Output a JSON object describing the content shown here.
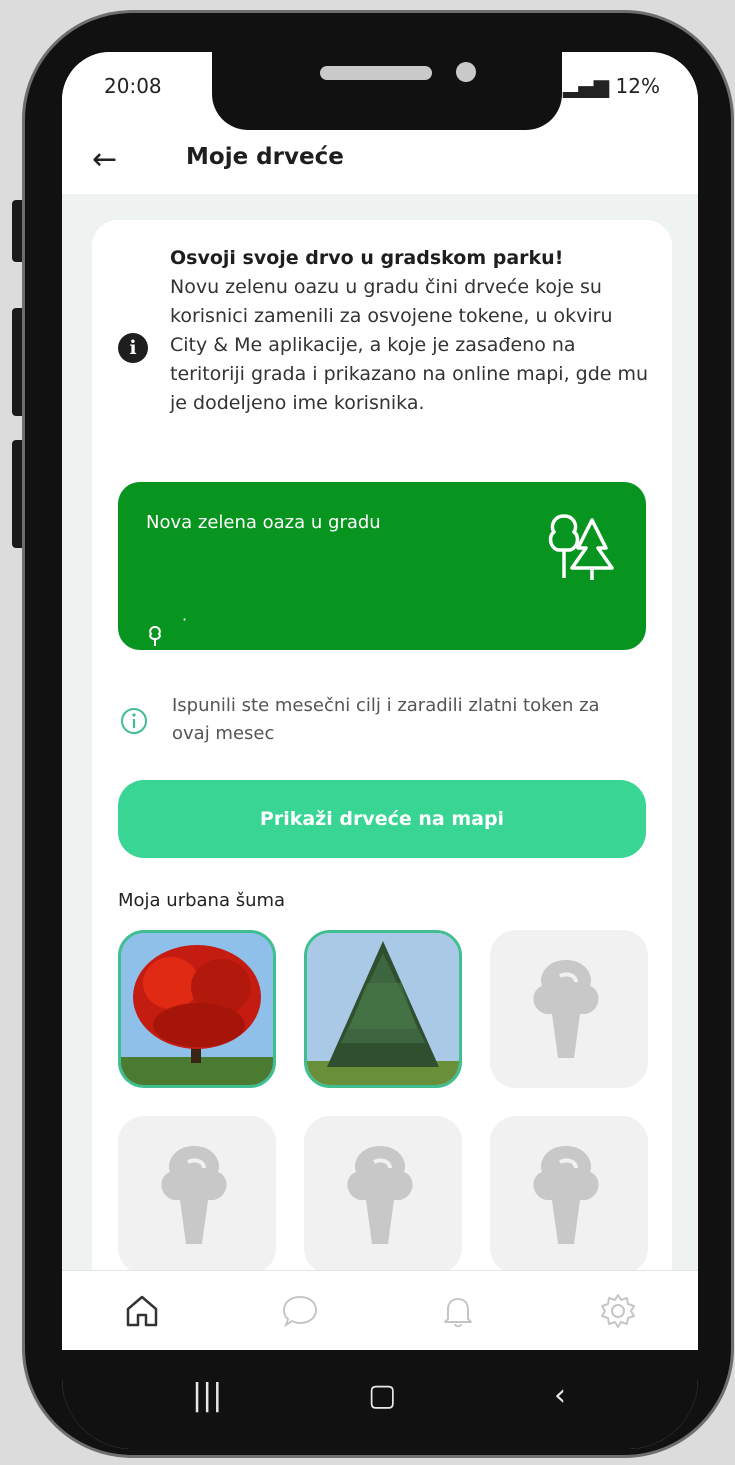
{
  "status_bar": {
    "time": "20:08",
    "battery": "12%"
  },
  "header": {
    "title": "Moje drveće"
  },
  "intro": {
    "title": "Osvoji svoje drvo u gradskom parku!",
    "text": "Novu zelenu oazu u gradu čini drveće koje su korisnici zamenili za osvojene tokene, u okviru City & Me aplikacije, a koje je zasađeno na teritoriji grada i prikazano na online mapi, gde mu je dodeljeno ime korisnika."
  },
  "banner": {
    "title": "Nova zelena oaza u gradu",
    "value": "·"
  },
  "note": {
    "text": "Ispunili ste mesečni cilj i zaradili zlatni token za ovaj mesec"
  },
  "actions": {
    "map_button": "Prikaži drveće na mapi"
  },
  "forest": {
    "title": "Moja urbana šuma",
    "tiles": [
      "red-maple-photo",
      "pine-tree-photo",
      "tree-placeholder-icon",
      "tree-placeholder-icon",
      "tree-placeholder-icon",
      "tree-placeholder-icon"
    ]
  },
  "nav": [
    "home-icon",
    "chat-icon",
    "bell-icon",
    "gear-icon"
  ],
  "colors": {
    "accent": "#38d594",
    "banner": "#08951f"
  }
}
